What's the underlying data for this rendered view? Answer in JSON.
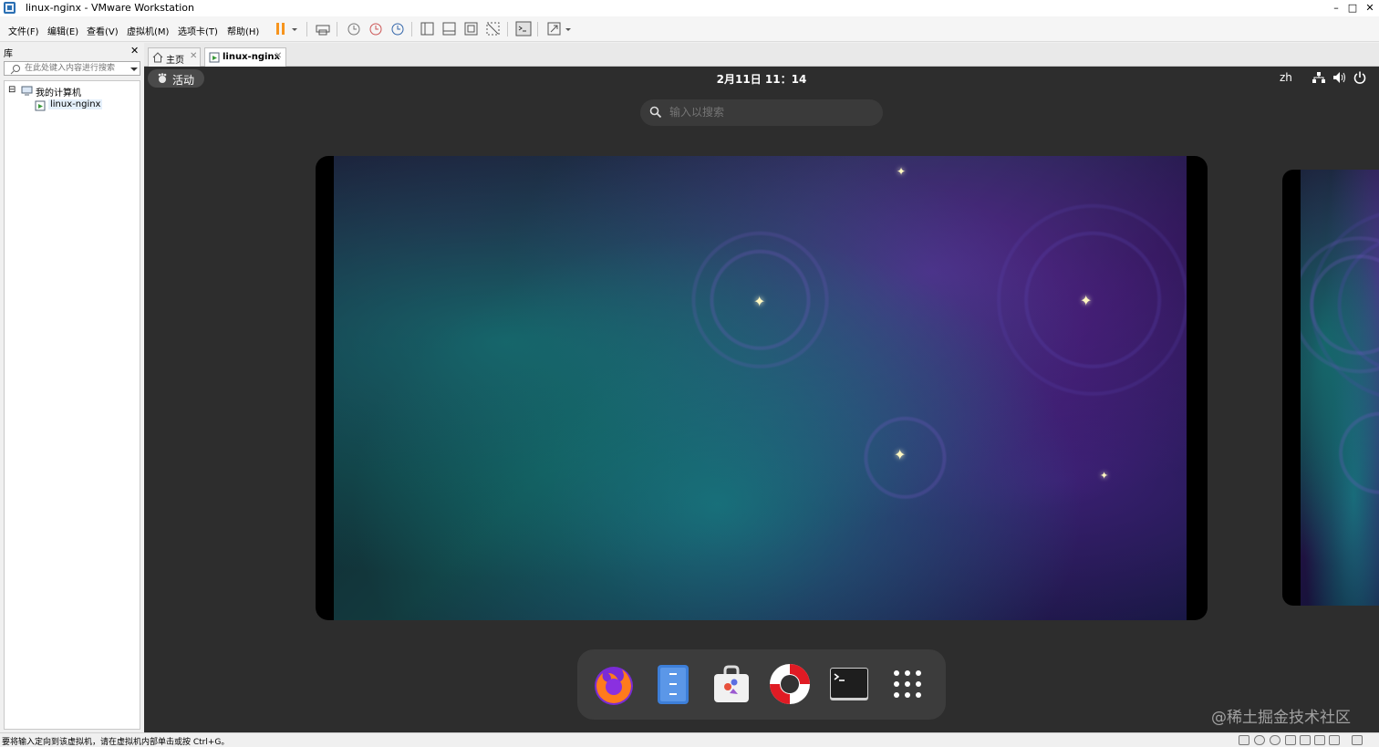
{
  "window": {
    "title": "linux-nginx - VMware Workstation",
    "controls": {
      "minimize": "–",
      "maximize": "□",
      "close": "✕"
    }
  },
  "menu": {
    "items": [
      "文件(F)",
      "编辑(E)",
      "查看(V)",
      "虚拟机(M)",
      "选项卡(T)",
      "帮助(H)"
    ]
  },
  "library": {
    "title": "库",
    "close": "✕",
    "search_placeholder": "在此处键入内容进行搜索",
    "tree": {
      "root_label": "我的计算机",
      "expander": "⊟",
      "child_label": "linux-nginx"
    }
  },
  "tabs": [
    {
      "label": "主页",
      "close": "✕"
    },
    {
      "label": "linux-nginx",
      "close": "✕",
      "active": true
    }
  ],
  "guest": {
    "activities_label": "活动",
    "clock": "2月11日  11：14",
    "language": "zh",
    "search_placeholder": "输入以搜索",
    "dock_apps": [
      "firefox-icon",
      "files-icon",
      "software-store-icon",
      "help-icon",
      "terminal-icon",
      "app-grid-icon"
    ]
  },
  "watermark": "@稀土掘金技术社区",
  "status": {
    "text": "要将输入定向到该虚拟机，请在虚拟机内部单击或按 Ctrl+G。"
  },
  "colors": {
    "accent_pause": "#f7941d",
    "vm_background": "#2d2d2d",
    "dock_background": "#3c3c3c"
  }
}
